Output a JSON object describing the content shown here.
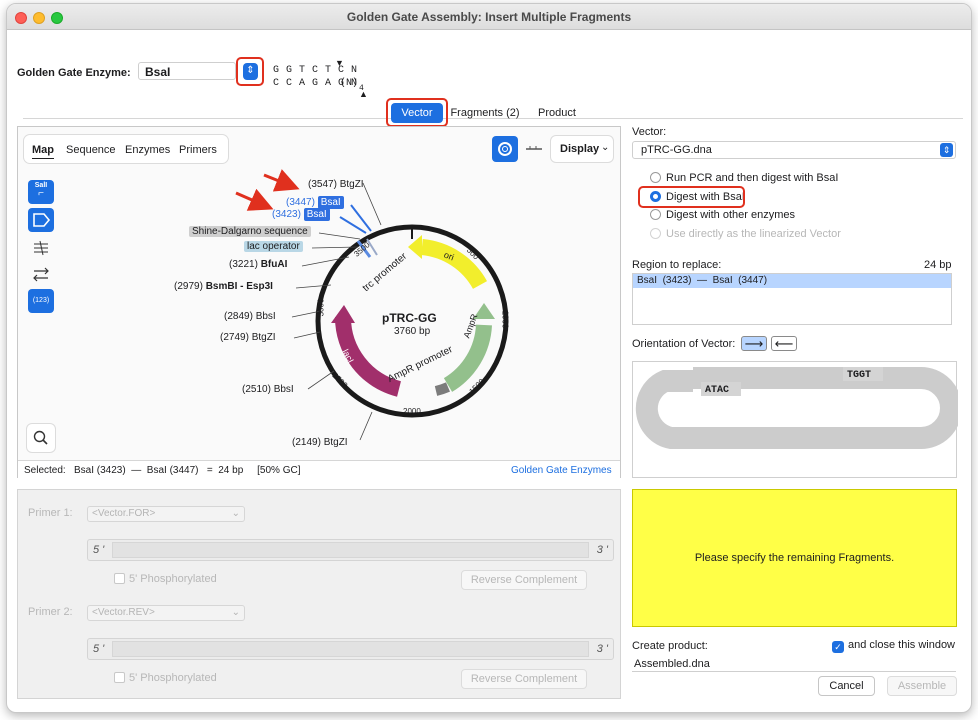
{
  "window": {
    "title": "Golden Gate Assembly: Insert Multiple Fragments"
  },
  "enzyme": {
    "label": "Golden Gate Enzyme:",
    "value": "BsaI",
    "site_top": "G G T C T C N",
    "site_bottom": "C C A G A G N",
    "site_suffix": "(N)",
    "site_sub": "4"
  },
  "tabs": [
    {
      "label": "Vector",
      "selected": true
    },
    {
      "label": "Fragments (2)",
      "selected": false
    },
    {
      "label": "Product",
      "selected": false
    }
  ],
  "map_view": {
    "tabs": [
      "Map",
      "Sequence",
      "Enzymes",
      "Primers"
    ],
    "display_label": "Display",
    "plasmid_name": "pTRC-GG",
    "plasmid_size": "3760 bp",
    "sali_label": "SalI",
    "counter_label": "(123)",
    "site_labels": [
      {
        "pos": "(3547)",
        "name": "BtgZI"
      },
      {
        "pos": "(3447)",
        "name": "BsaI"
      },
      {
        "pos": "(3423)",
        "name": "BsaI"
      },
      {
        "pos": "(3221)",
        "name": "BfuAI"
      },
      {
        "pos": "(2979)",
        "name": "BsmBI - Esp3I"
      },
      {
        "pos": "(2849)",
        "name": "BbsI"
      },
      {
        "pos": "(2749)",
        "name": "BtgZI"
      },
      {
        "pos": "(2510)",
        "name": "BbsI"
      },
      {
        "pos": "(2149)",
        "name": "BtgZI"
      }
    ],
    "feature_labels": {
      "shine": "Shine-Dalgarno sequence",
      "lac_operator": "lac operator",
      "trc": "trc promoter",
      "ori": "ori",
      "ampr": "AmpR",
      "ampr_promoter": "AmpR promoter",
      "laci": "lacI"
    },
    "ring_ticks": [
      "500",
      "1000",
      "1500",
      "2000",
      "2500",
      "3000",
      "3500"
    ],
    "status_selected_label": "Selected:",
    "status_selected_value": "BsaI (3423)  —  BsaI (3447)   =  24 bp     [50% GC]",
    "status_link": "Golden Gate Enzymes"
  },
  "vector": {
    "label": "Vector:",
    "value": "pTRC-GG.dna",
    "options": [
      {
        "label": "Run PCR and then digest with BsaI",
        "selected": false,
        "disabled": false
      },
      {
        "label": "Digest with BsaI",
        "selected": true,
        "disabled": false
      },
      {
        "label": "Digest with other enzymes",
        "selected": false,
        "disabled": false
      },
      {
        "label": "Use directly as the linearized Vector",
        "selected": false,
        "disabled": true
      }
    ],
    "region_label": "Region to replace:",
    "region_size": "24 bp",
    "region_value": "BsaI  (3423)  —  BsaI  (3447)",
    "orientation_label": "Orientation of Vector:",
    "overhang_left": "ATAC",
    "overhang_right": "TGGT"
  },
  "primers": {
    "primer1_label": "Primer 1:",
    "primer1_value": "<Vector.FOR>",
    "primer2_label": "Primer 2:",
    "primer2_value": "<Vector.REV>",
    "five": "5 '",
    "three": "3 '",
    "phosphorylated": "5' Phosphorylated",
    "reverse_complement": "Reverse Complement"
  },
  "message": "Please specify the remaining Fragments.",
  "product": {
    "label": "Create product:",
    "close_label": "and close this window",
    "close_checked": true,
    "name": "Assembled.dna"
  },
  "buttons": {
    "cancel": "Cancel",
    "assemble": "Assemble"
  },
  "colors": {
    "accent": "#1d6fe0",
    "highlight_red": "#e0301e",
    "message_bg": "#ffff47",
    "ori": "#f2ee2c",
    "ampr": "#93c08c",
    "laci": "#a12f6b"
  }
}
